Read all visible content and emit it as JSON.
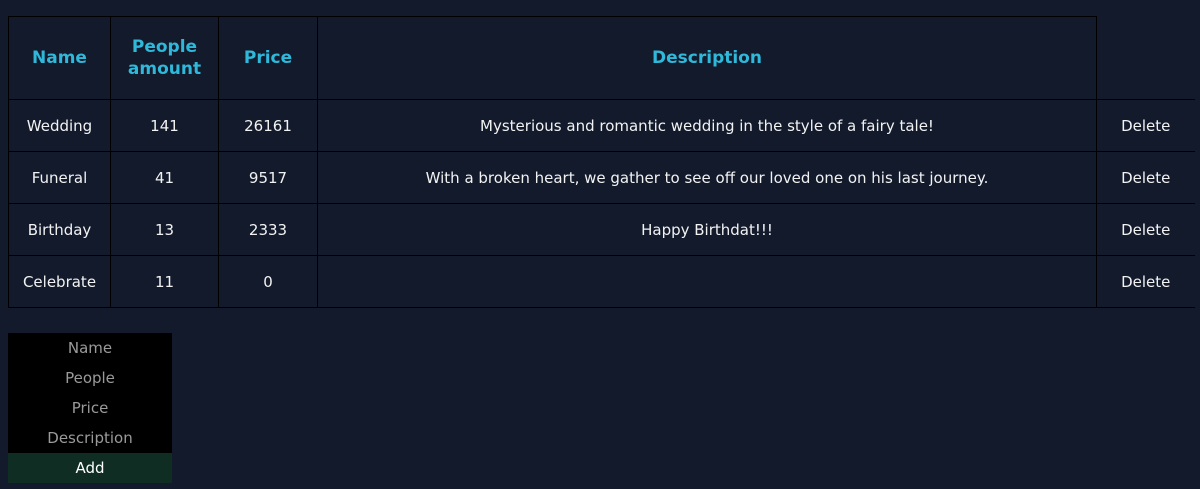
{
  "table": {
    "headers": {
      "name": "Name",
      "people": "People amount",
      "price": "Price",
      "description": "Description"
    },
    "rows": [
      {
        "name": "Wedding",
        "people": "141",
        "price": "26161",
        "description": "Mysterious and romantic wedding in the style of a fairy tale!",
        "action": "Delete"
      },
      {
        "name": "Funeral",
        "people": "41",
        "price": "9517",
        "description": "With a broken heart, we gather to see off our loved one on his last journey.",
        "action": "Delete"
      },
      {
        "name": "Birthday",
        "people": "13",
        "price": "2333",
        "description": "Happy Birthdat!!!",
        "action": "Delete"
      },
      {
        "name": "Celebrate",
        "people": "11",
        "price": "0",
        "description": "",
        "action": "Delete"
      }
    ]
  },
  "form": {
    "name_placeholder": "Name",
    "people_placeholder": "People",
    "price_placeholder": "Price",
    "description_placeholder": "Description",
    "add_label": "Add"
  },
  "colors": {
    "background": "#121a2b",
    "header_text": "#2fb8da",
    "add_button_bg": "#0f2d22"
  }
}
